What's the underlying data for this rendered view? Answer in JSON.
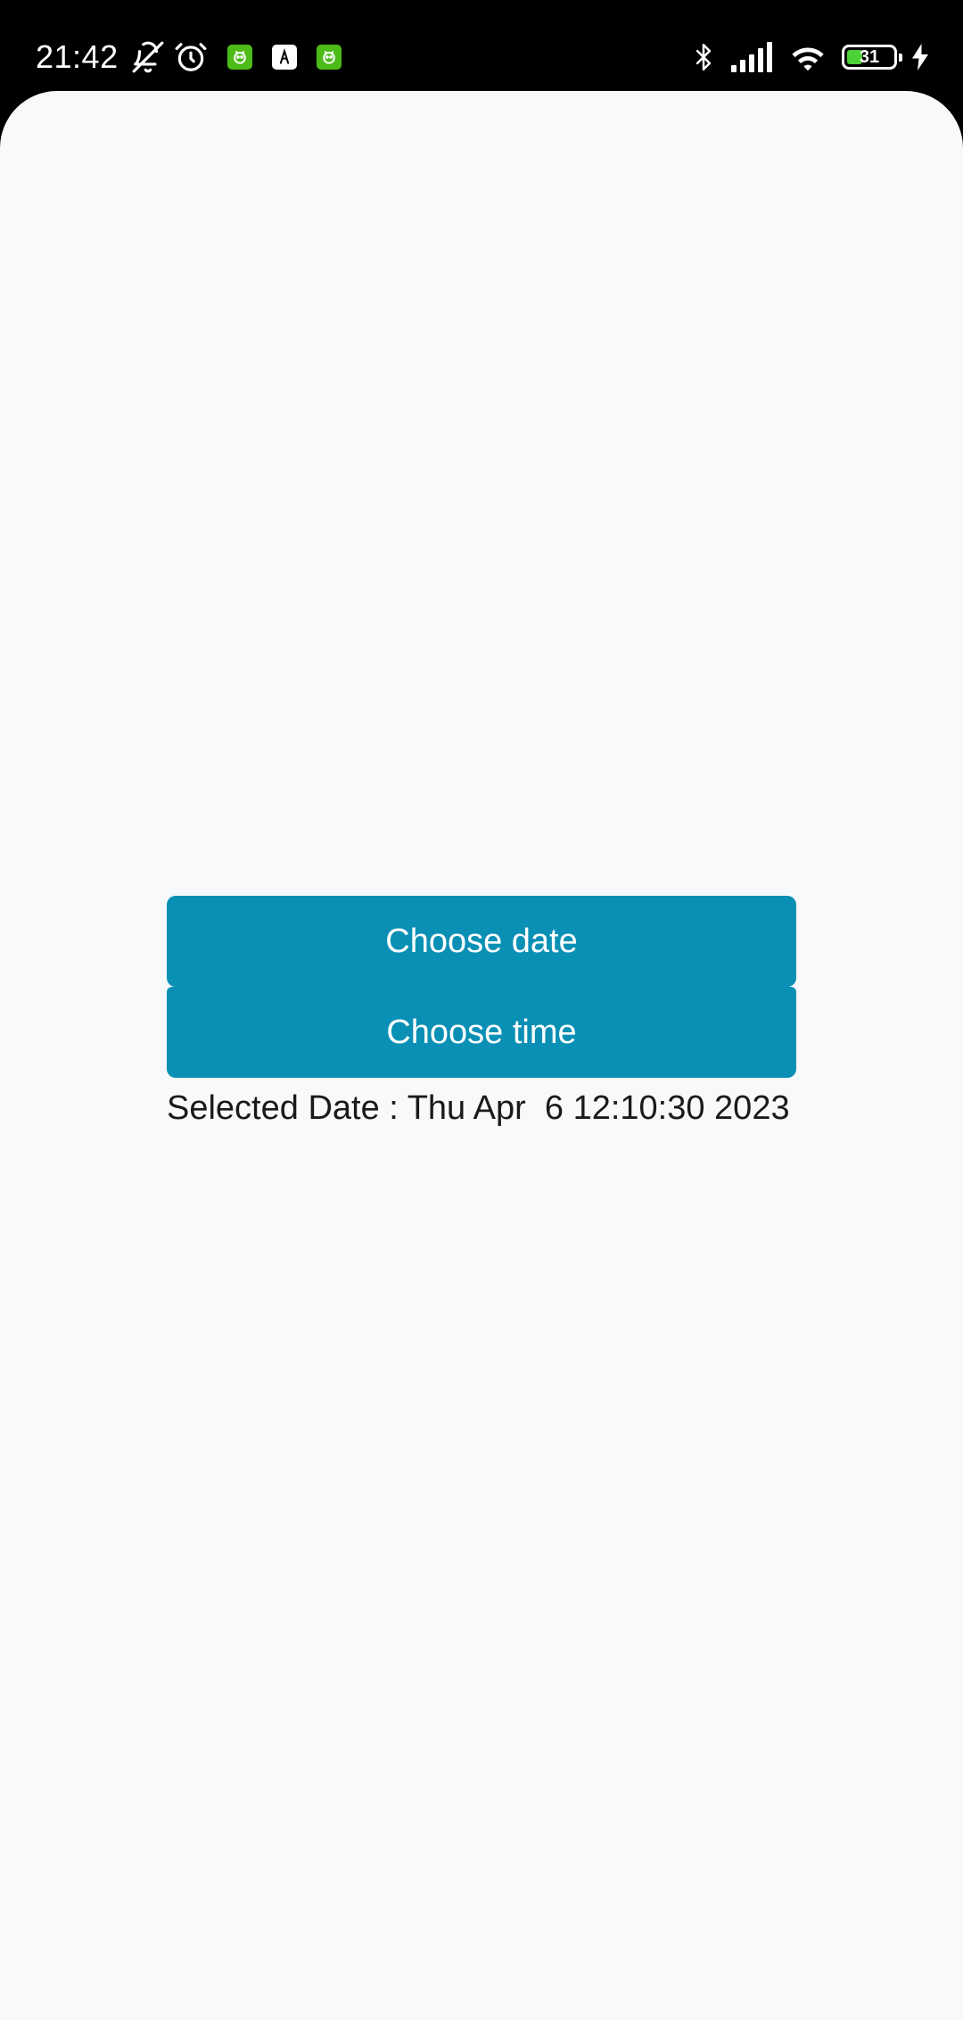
{
  "status_bar": {
    "time": "21:42",
    "left_icons": [
      "bell-off-icon",
      "alarm-icon",
      "app-notification-icon",
      "app-notification-icon",
      "app-notification-icon"
    ],
    "right_icons": [
      "bluetooth-icon",
      "cellular-signal-icon",
      "wifi-icon",
      "battery-icon",
      "charging-icon"
    ],
    "battery_level": "31",
    "battery_color": "#4cd137",
    "app_badge_color": "#4cbb17"
  },
  "main": {
    "choose_date_label": "Choose date",
    "choose_time_label": "Choose time",
    "selected_date_text": "Selected Date : Thu Apr  6 12:10:30 2023"
  },
  "colors": {
    "button_bg": "#0a90b5",
    "surface_bg": "#f8f9fb"
  }
}
